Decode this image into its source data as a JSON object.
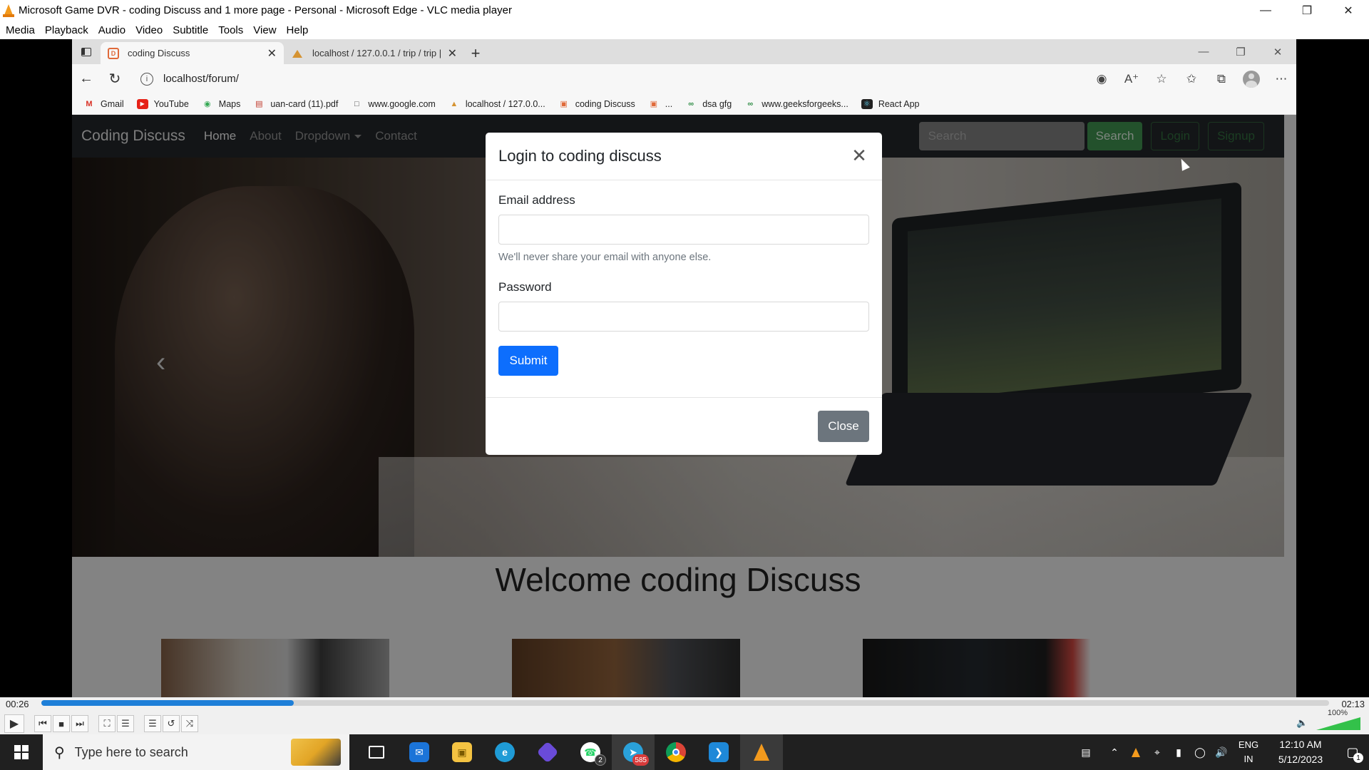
{
  "vlc": {
    "title": "Microsoft Game DVR - coding Discuss and 1 more page - Personal - Microsoft Edge - VLC media player",
    "menu": [
      "Media",
      "Playback",
      "Audio",
      "Video",
      "Subtitle",
      "Tools",
      "View",
      "Help"
    ],
    "time_current": "00:26",
    "time_total": "02:13",
    "progress": 0.196,
    "volume": "100%"
  },
  "edge": {
    "tabs": [
      {
        "label": "coding Discuss",
        "active": true
      },
      {
        "label": "localhost / 127.0.0.1 / trip / trip |",
        "active": false
      }
    ],
    "address": "localhost/forum/",
    "favorites": [
      {
        "label": "Gmail",
        "icon": "gmail-icon"
      },
      {
        "label": "YouTube",
        "icon": "youtube-icon"
      },
      {
        "label": "Maps",
        "icon": "maps-icon"
      },
      {
        "label": "uan-card (11).pdf",
        "icon": "pdf-icon"
      },
      {
        "label": "www.google.com",
        "icon": "page-icon"
      },
      {
        "label": "localhost / 127.0.0...",
        "icon": "phpmyadmin-icon"
      },
      {
        "label": "coding Discuss",
        "icon": "site-icon"
      },
      {
        "label": "...",
        "icon": "site-icon"
      },
      {
        "label": "dsa gfg",
        "icon": "gfg-icon"
      },
      {
        "label": "www.geeksforgeeks...",
        "icon": "gfg-icon"
      },
      {
        "label": "React App",
        "icon": "react-icon"
      }
    ]
  },
  "site": {
    "brand": "Coding Discuss",
    "nav": [
      "Home",
      "About",
      "Dropdown",
      "Contact"
    ],
    "search_placeholder": "Search",
    "search_button": "Search",
    "login_button": "Login",
    "signup_button": "Signup",
    "welcome": "Welcome coding Discuss"
  },
  "modal": {
    "title": "Login to coding discuss",
    "email_label": "Email address",
    "email_help": "We'll never share your email with anyone else.",
    "password_label": "Password",
    "submit": "Submit",
    "close": "Close"
  },
  "taskbar": {
    "search_placeholder": "Type here to search",
    "whatsapp_badge": "2",
    "telegram_badge": "585",
    "lang_top": "ENG",
    "lang_bottom": "IN",
    "time": "12:10 AM",
    "date": "5/12/2023",
    "notifications": "1"
  }
}
